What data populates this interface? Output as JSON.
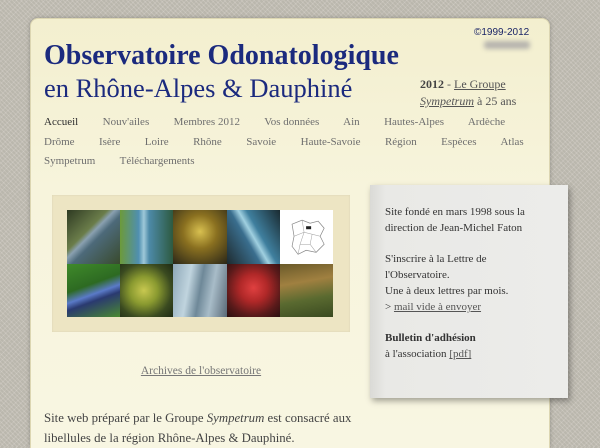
{
  "copyright": "©1999-2012",
  "header": {
    "title_line1": "Observatoire Odonatologique",
    "title_line2": "en Rhône-Alpes & Dauphiné",
    "news_year": "2012",
    "news_sep": " - ",
    "news_link": "Le Groupe",
    "news_link_italic": "Sympetrum",
    "news_tail": " à 25 ans"
  },
  "nav": {
    "rows": [
      [
        "Accueil",
        "Nouv'ailes",
        "Membres 2012",
        "Vos données",
        "Ain",
        "Hautes-Alpes",
        "Ardèche"
      ],
      [
        "Drôme",
        "Isère",
        "Loire",
        "Rhône",
        "Savoie",
        "Haute-Savoie",
        "Région",
        "Espèces",
        "Atlas"
      ],
      [
        "Sympetrum",
        "Téléchargements"
      ]
    ]
  },
  "gallery": {
    "archive_link": "Archives de l'observatoire"
  },
  "sidebar": {
    "founded_line1": "Site fondé en mars 1998 sous la",
    "founded_line2": "direction de Jean-Michel Faton",
    "newsletter_line1": "S'inscrire à la Lettre de",
    "newsletter_line2": "l'Observatoire.",
    "newsletter_line3": "Une à deux lettres par mois.",
    "mail_prefix": "> ",
    "mail_link": "mail vide à envoyer",
    "membership_title": "Bulletin d'adhésion",
    "membership_text": "à l'association ",
    "pdf_link": "[pdf]"
  },
  "intro": {
    "text_before": "Site web préparé par le Groupe ",
    "text_italic": "Sympetrum",
    "text_after": " est consacré aux",
    "line2": "libellules de la région Rhône-Alpes & Dauphiné."
  },
  "colors": {
    "title": "#1b2a7e",
    "panel": "#f6f3da",
    "background": "#c8c4ba",
    "sidebar": "#e9e9e6"
  }
}
